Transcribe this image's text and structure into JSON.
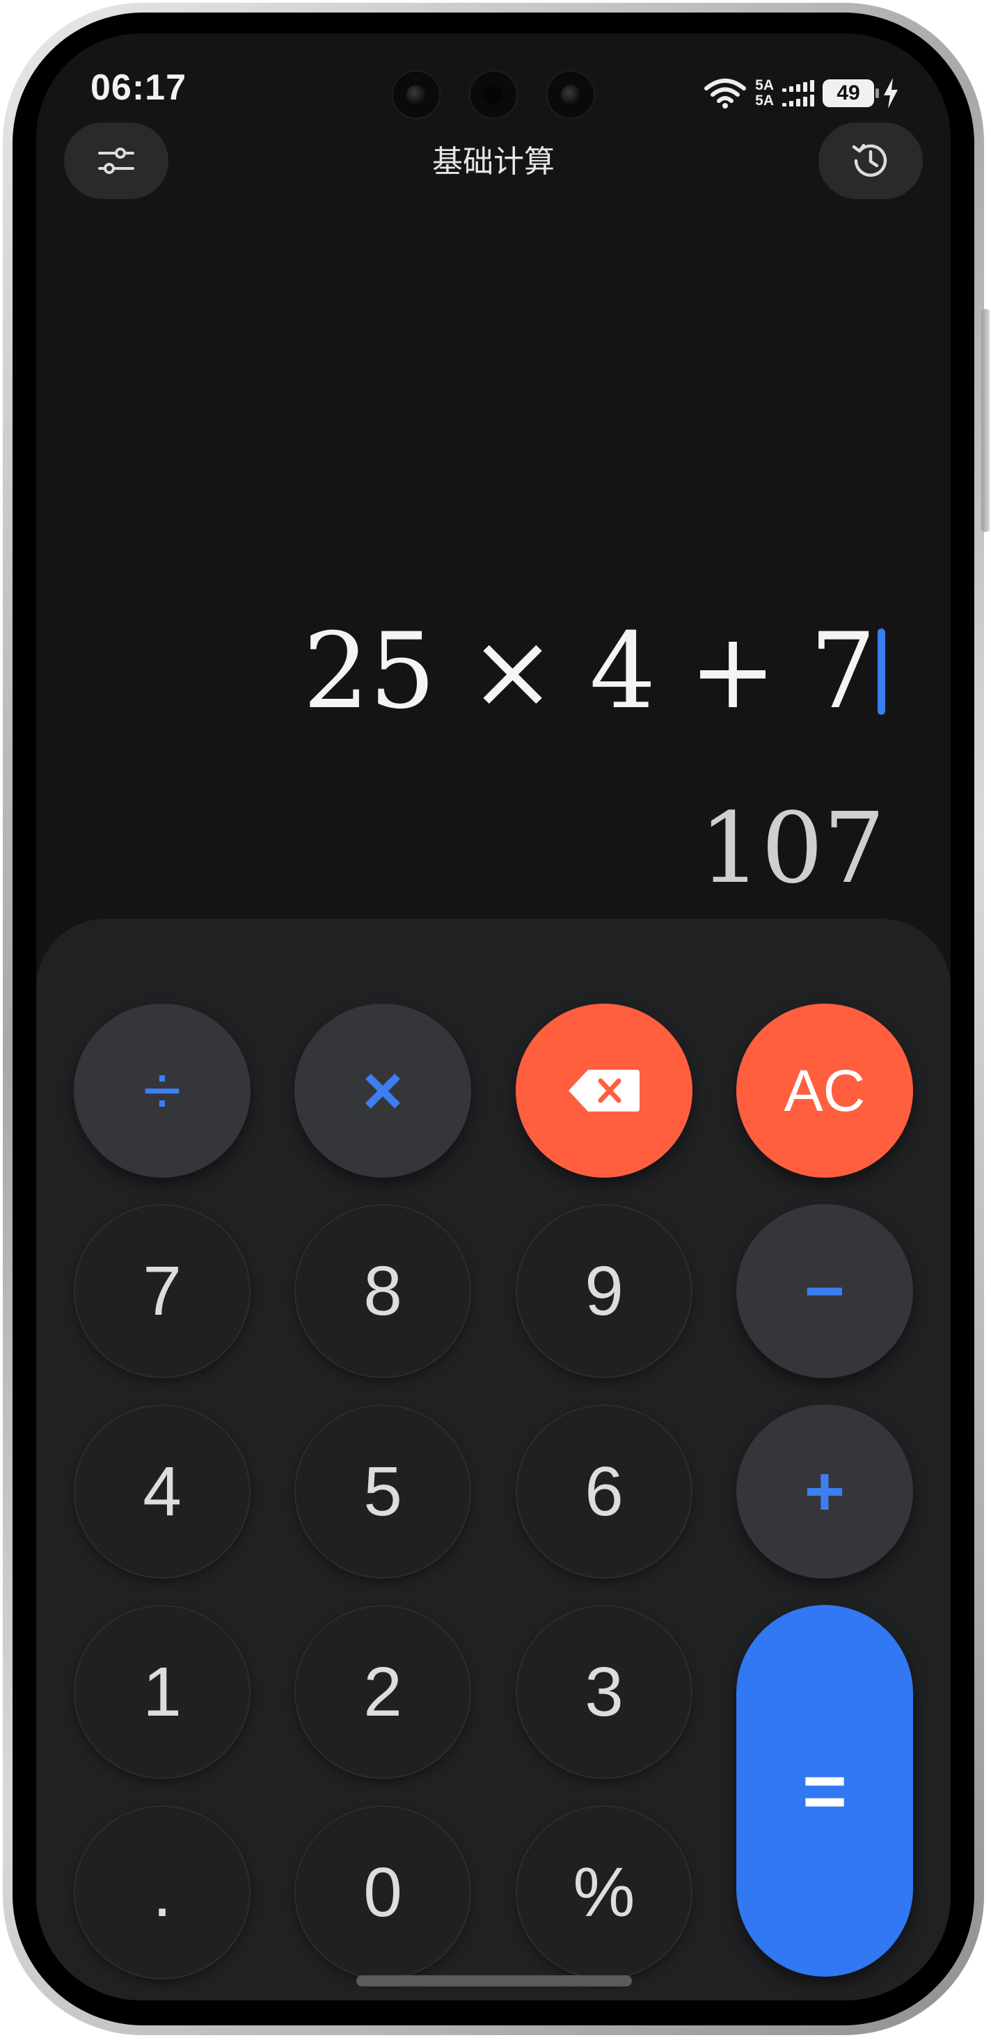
{
  "status_bar": {
    "time": "06:17",
    "network_top": "5A",
    "network_bottom": "5A",
    "battery": "49"
  },
  "header": {
    "title": "基础计算",
    "settings_icon": "sliders-icon",
    "history_icon": "history-clock-icon"
  },
  "display": {
    "expression": "25 × 4 + 7",
    "result": "107"
  },
  "keys": {
    "divide": "÷",
    "multiply": "×",
    "backspace_icon": "backspace-icon",
    "clear": "AC",
    "seven": "7",
    "eight": "8",
    "nine": "9",
    "minus": "−",
    "four": "4",
    "five": "5",
    "six": "6",
    "plus": "+",
    "one": "1",
    "two": "2",
    "three": "3",
    "equals": "=",
    "decimal": ".",
    "zero": "0",
    "percent": "%"
  },
  "colors": {
    "accent_blue": "#3178f2",
    "clear_red": "#ff5f3f",
    "background": "#141415",
    "keypad": "#202123"
  }
}
